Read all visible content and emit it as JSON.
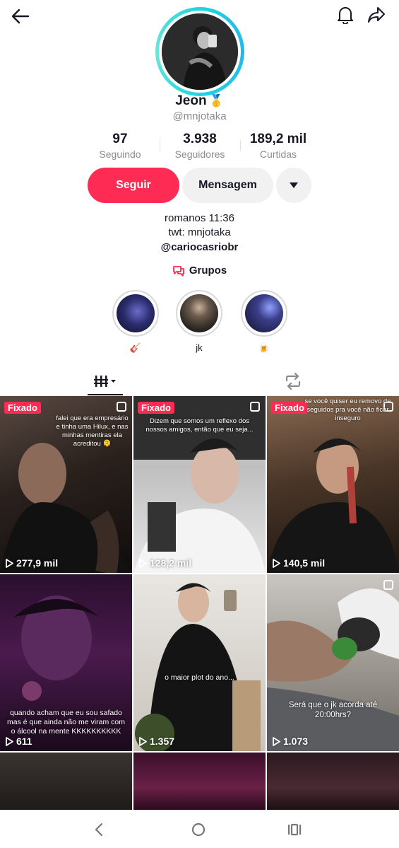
{
  "profile": {
    "name": "Jeon",
    "badge_emoji": "🥇",
    "handle": "@mnjotaka"
  },
  "stats": [
    {
      "value": "97",
      "label": "Seguindo"
    },
    {
      "value": "3.938",
      "label": "Seguidores"
    },
    {
      "value": "189,2 mil",
      "label": "Curtidas"
    }
  ],
  "actions": {
    "follow_label": "Seguir",
    "message_label": "Mensagem"
  },
  "bio": {
    "line1": "romanos 11:36",
    "line2": "twt: mnjotaka",
    "link": "@cariocasriobr"
  },
  "groups_label": "Grupos",
  "highlights": [
    {
      "label": "🎸"
    },
    {
      "label": "jk"
    },
    {
      "label": "🍺"
    }
  ],
  "videos": [
    {
      "pinned_label": "Fixado",
      "caption": "falei que era empresário e tinha uma Hilux, e nas minhas mentiras ela acreditou 🫠",
      "views": "277,9 mil"
    },
    {
      "pinned_label": "Fixado",
      "caption": "Dizem que somos um reflexo dos nossos amigos, então que eu seja...",
      "views": "128,2 mil"
    },
    {
      "pinned_label": "Fixado",
      "caption": "se você quiser eu removo de seguidos pra você não ficar inseguro",
      "views": "140,5 mil"
    },
    {
      "pinned_label": "",
      "caption": "quando acham que eu sou safado mas é que ainda não me viram com o álcool na mente KKKKKKKKKK",
      "views": "611"
    },
    {
      "pinned_label": "",
      "caption": "o maior plot do ano...",
      "views": "1.357"
    },
    {
      "pinned_label": "",
      "caption": "Será que o jk acorda até 20:00hrs?",
      "views": "1.073"
    }
  ],
  "colors": {
    "accent": "#fe2c55",
    "ring": "#1fd5e0"
  }
}
